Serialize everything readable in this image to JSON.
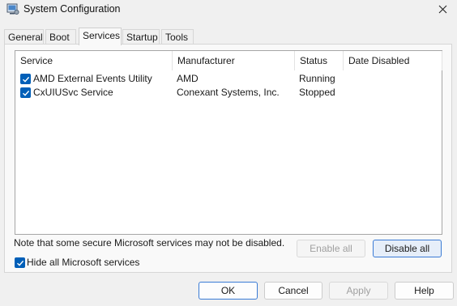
{
  "window": {
    "title": "System Configuration"
  },
  "tabs": [
    {
      "label": "General",
      "active": false
    },
    {
      "label": "Boot",
      "active": false
    },
    {
      "label": "Services",
      "active": true
    },
    {
      "label": "Startup",
      "active": false
    },
    {
      "label": "Tools",
      "active": false
    }
  ],
  "services": {
    "columns": [
      "Service",
      "Manufacturer",
      "Status",
      "Date Disabled"
    ],
    "rows": [
      {
        "checked": true,
        "service": "AMD External Events Utility",
        "manufacturer": "AMD",
        "status": "Running",
        "date_disabled": ""
      },
      {
        "checked": true,
        "service": "CxUIUSvc Service",
        "manufacturer": "Conexant Systems, Inc.",
        "status": "Stopped",
        "date_disabled": ""
      }
    ]
  },
  "note": "Note that some secure Microsoft services may not be disabled.",
  "buttons": {
    "enable_all": "Enable all",
    "disable_all": "Disable all",
    "ok": "OK",
    "cancel": "Cancel",
    "apply": "Apply",
    "help": "Help"
  },
  "hide_ms": {
    "label": "Hide all Microsoft services",
    "checked": true
  },
  "colors": {
    "accent": "#005fb8",
    "focus_border": "#3a7bd5"
  },
  "icons": {
    "app": "system-config-icon",
    "close": "close-icon",
    "check": "checkmark-icon"
  }
}
